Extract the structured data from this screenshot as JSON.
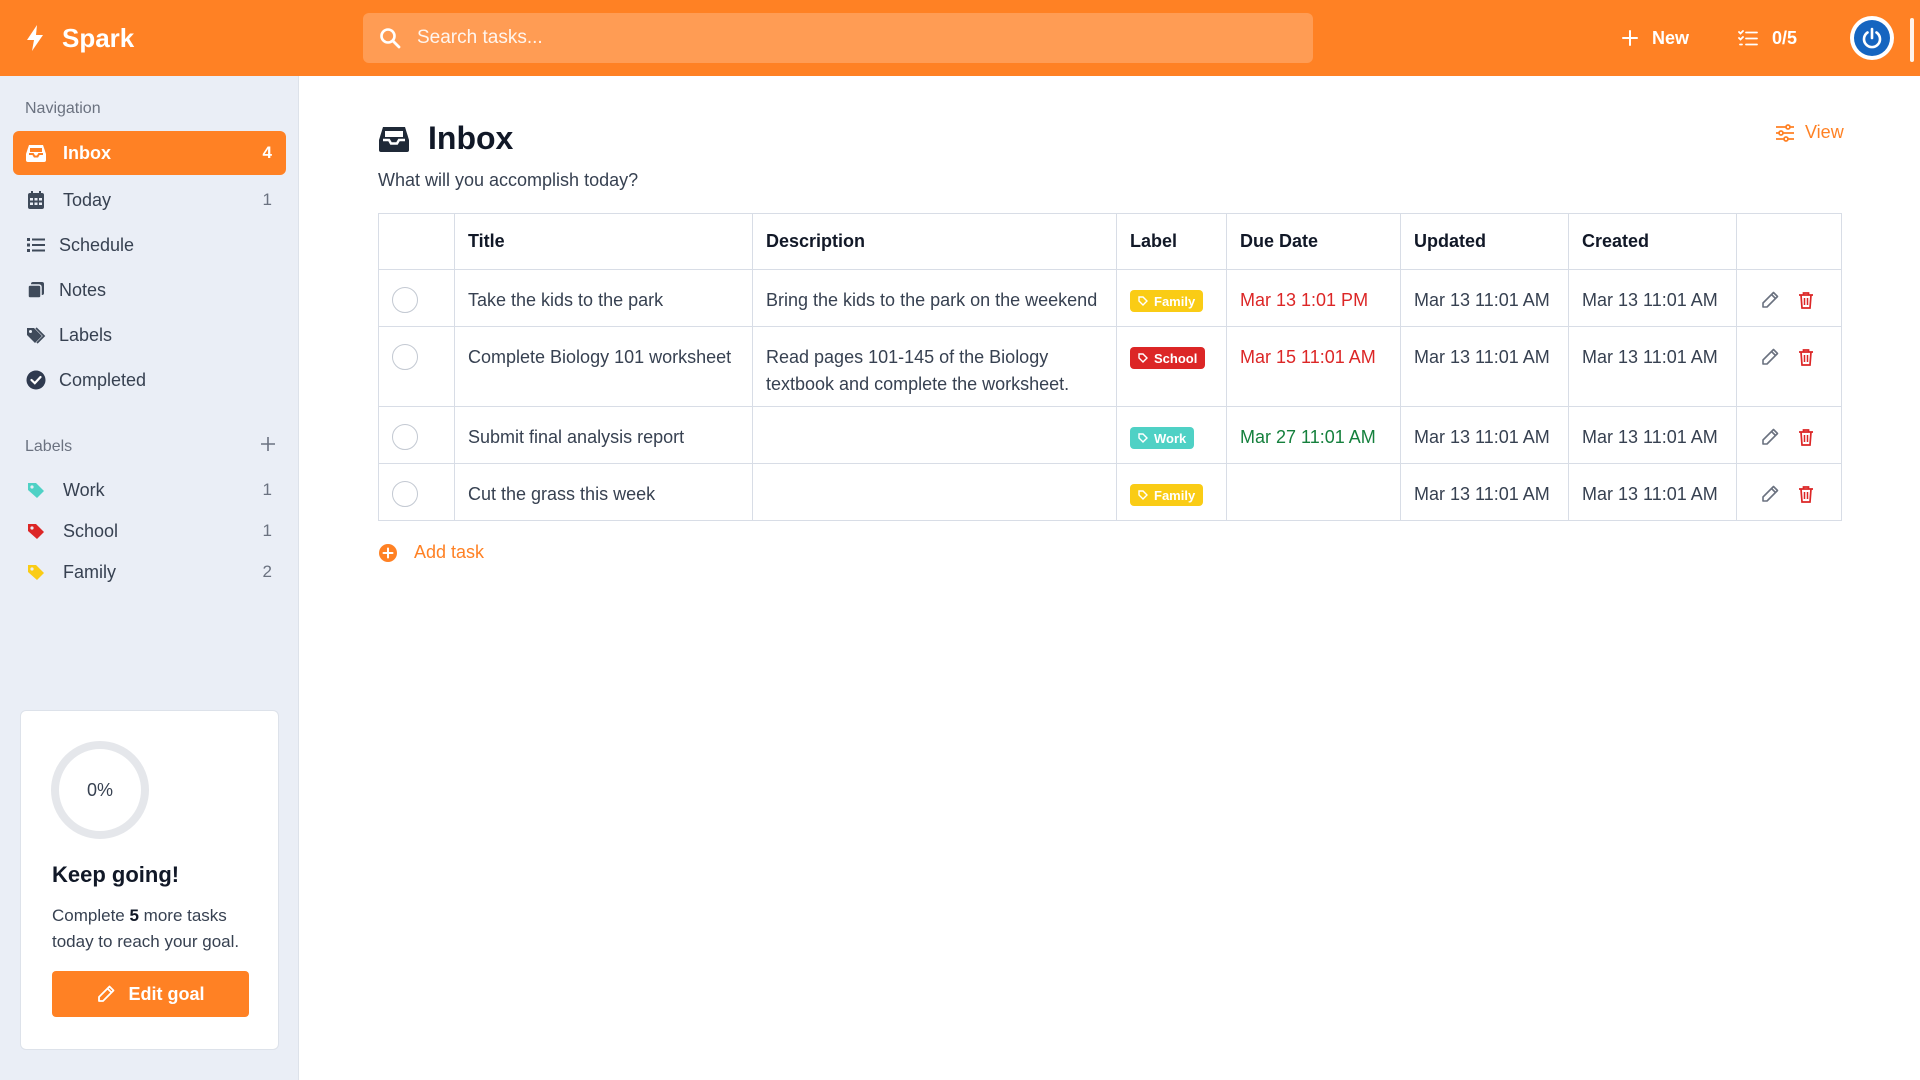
{
  "app": {
    "name": "Spark"
  },
  "colors": {
    "accent": "#ff8124",
    "overdue": "#dc2626",
    "upcoming": "#15803d"
  },
  "header": {
    "search_placeholder": "Search tasks...",
    "new_label": "New",
    "progress_label": "0/5"
  },
  "sidebar": {
    "nav_title": "Navigation",
    "items": [
      {
        "label": "Inbox",
        "count": "4",
        "icon": "inbox-icon"
      },
      {
        "label": "Today",
        "count": "1",
        "icon": "calendar-icon"
      },
      {
        "label": "Schedule",
        "count": "",
        "icon": "list-icon"
      },
      {
        "label": "Notes",
        "count": "",
        "icon": "notes-icon"
      },
      {
        "label": "Labels",
        "count": "",
        "icon": "tags-icon"
      },
      {
        "label": "Completed",
        "count": "",
        "icon": "check-circle-icon"
      }
    ],
    "labels_title": "Labels",
    "labels": [
      {
        "label": "Work",
        "count": "1",
        "color": "#4fd1c5"
      },
      {
        "label": "School",
        "count": "1",
        "color": "#dc2626"
      },
      {
        "label": "Family",
        "count": "2",
        "color": "#facc15"
      }
    ]
  },
  "goal": {
    "percent": "0%",
    "progress": 0,
    "title": "Keep going!",
    "text_pre": "Complete ",
    "text_count": "5",
    "text_post": " more tasks today to reach your goal.",
    "button": "Edit goal"
  },
  "main": {
    "title": "Inbox",
    "subtitle": "What will you accomplish today?",
    "view_label": "View",
    "columns": [
      "Title",
      "Description",
      "Label",
      "Due Date",
      "Updated",
      "Created"
    ],
    "rows": [
      {
        "title": "Take the kids to the park",
        "description": "Bring the kids to the park on the weekend",
        "label": "Family",
        "label_color": "#facc15",
        "due": "Mar 13 1:01 PM",
        "due_color": "#dc2626",
        "updated": "Mar 13 11:01 AM",
        "created": "Mar 13 11:01 AM"
      },
      {
        "title": "Complete Biology 101 worksheet",
        "description": "Read pages 101-145 of the Biology textbook and complete the worksheet.",
        "label": "School",
        "label_color": "#dc2626",
        "due": "Mar 15 11:01 AM",
        "due_color": "#dc2626",
        "updated": "Mar 13 11:01 AM",
        "created": "Mar 13 11:01 AM"
      },
      {
        "title": "Submit final analysis report",
        "description": "",
        "label": "Work",
        "label_color": "#4fd1c5",
        "due": "Mar 27 11:01 AM",
        "due_color": "#15803d",
        "updated": "Mar 13 11:01 AM",
        "created": "Mar 13 11:01 AM"
      },
      {
        "title": "Cut the grass this week",
        "description": "",
        "label": "Family",
        "label_color": "#facc15",
        "due": "",
        "due_color": "#374151",
        "updated": "Mar 13 11:01 AM",
        "created": "Mar 13 11:01 AM"
      }
    ],
    "add_task_label": "Add task"
  }
}
